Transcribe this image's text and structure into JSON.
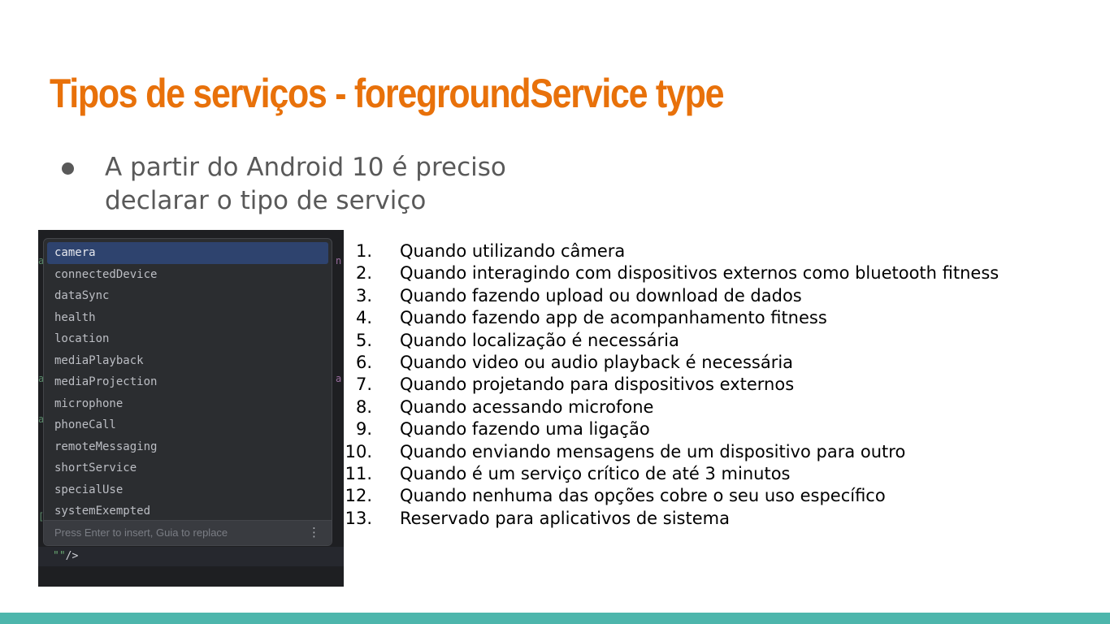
{
  "slide": {
    "title": "Tipos de serviços - foregroundService type",
    "bullet": {
      "line1": "A partir do Android 10 é preciso",
      "line2": "declarar o tipo de serviço"
    },
    "accent_color": "#e8710a",
    "footer_color": "#4db6ac"
  },
  "ide": {
    "code_text": "/>",
    "code_quotes": "\"\"",
    "popup": {
      "items": [
        "camera",
        "connectedDevice",
        "dataSync",
        "health",
        "location",
        "mediaPlayback",
        "mediaProjection",
        "microphone",
        "phoneCall",
        "remoteMessaging",
        "shortService",
        "specialUse",
        "systemExempted"
      ],
      "selected": "camera",
      "hint": "Press Enter to insert, Guia to replace",
      "menu_icon": "more-vertical-icon"
    }
  },
  "list": [
    {
      "n": "1.",
      "text": "Quando utilizando câmera"
    },
    {
      "n": "2.",
      "text": "Quando interagindo com dispositivos externos como bluetooth fitness"
    },
    {
      "n": "3.",
      "text": "Quando fazendo upload ou download de dados"
    },
    {
      "n": "4.",
      "text": "Quando fazendo app de acompanhamento fitness"
    },
    {
      "n": "5.",
      "text": "Quando localização é necessária"
    },
    {
      "n": "6.",
      "text": "Quando video ou audio playback é necessária"
    },
    {
      "n": "7.",
      "text": "Quando projetando para dispositivos externos"
    },
    {
      "n": "8.",
      "text": "Quando acessando microfone"
    },
    {
      "n": "9.",
      "text": "Quando fazendo uma ligação"
    },
    {
      "n": "10.",
      "text": "Quando enviando mensagens de um dispositivo para outro"
    },
    {
      "n": "11.",
      "text": "Quando é um serviço crítico de até 3 minutos"
    },
    {
      "n": "12.",
      "text": "Quando nenhuma das opções cobre o seu uso específico"
    },
    {
      "n": "13.",
      "text": "Reservado para aplicativos de sistema"
    }
  ]
}
